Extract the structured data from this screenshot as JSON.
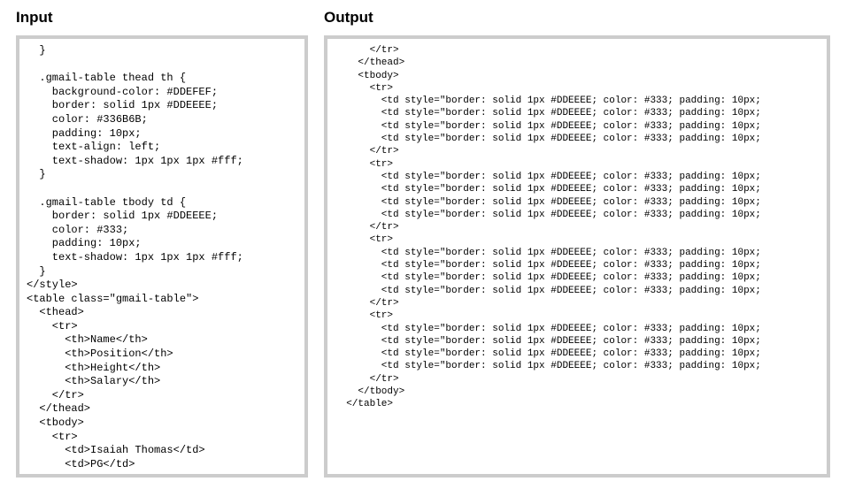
{
  "headings": {
    "input": "Input",
    "output": "Output"
  },
  "input_lines": [
    "  }",
    "",
    "  .gmail-table thead th {",
    "    background-color: #DDEFEF;",
    "    border: solid 1px #DDEEEE;",
    "    color: #336B6B;",
    "    padding: 10px;",
    "    text-align: left;",
    "    text-shadow: 1px 1px 1px #fff;",
    "  }",
    "",
    "  .gmail-table tbody td {",
    "    border: solid 1px #DDEEEE;",
    "    color: #333;",
    "    padding: 10px;",
    "    text-shadow: 1px 1px 1px #fff;",
    "  }",
    "</style>",
    "<table class=\"gmail-table\">",
    "  <thead>",
    "    <tr>",
    "      <th>Name</th>",
    "      <th>Position</th>",
    "      <th>Height</th>",
    "      <th>Salary</th>",
    "    </tr>",
    "  </thead>",
    "  <tbody>",
    "    <tr>",
    "      <td>Isaiah Thomas</td>",
    "      <td>PG</td>"
  ],
  "output_lines": [
    "      </tr>",
    "    </thead>",
    "    <tbody>",
    "      <tr>",
    "        <td style=\"border: solid 1px #DDEEEE; color: #333; padding: 10px;",
    "        <td style=\"border: solid 1px #DDEEEE; color: #333; padding: 10px;",
    "        <td style=\"border: solid 1px #DDEEEE; color: #333; padding: 10px;",
    "        <td style=\"border: solid 1px #DDEEEE; color: #333; padding: 10px;",
    "      </tr>",
    "      <tr>",
    "        <td style=\"border: solid 1px #DDEEEE; color: #333; padding: 10px;",
    "        <td style=\"border: solid 1px #DDEEEE; color: #333; padding: 10px;",
    "        <td style=\"border: solid 1px #DDEEEE; color: #333; padding: 10px;",
    "        <td style=\"border: solid 1px #DDEEEE; color: #333; padding: 10px;",
    "      </tr>",
    "      <tr>",
    "        <td style=\"border: solid 1px #DDEEEE; color: #333; padding: 10px;",
    "        <td style=\"border: solid 1px #DDEEEE; color: #333; padding: 10px;",
    "        <td style=\"border: solid 1px #DDEEEE; color: #333; padding: 10px;",
    "        <td style=\"border: solid 1px #DDEEEE; color: #333; padding: 10px;",
    "      </tr>",
    "      <tr>",
    "        <td style=\"border: solid 1px #DDEEEE; color: #333; padding: 10px;",
    "        <td style=\"border: solid 1px #DDEEEE; color: #333; padding: 10px;",
    "        <td style=\"border: solid 1px #DDEEEE; color: #333; padding: 10px;",
    "        <td style=\"border: solid 1px #DDEEEE; color: #333; padding: 10px;",
    "      </tr>",
    "    </tbody>",
    "  </table>"
  ]
}
